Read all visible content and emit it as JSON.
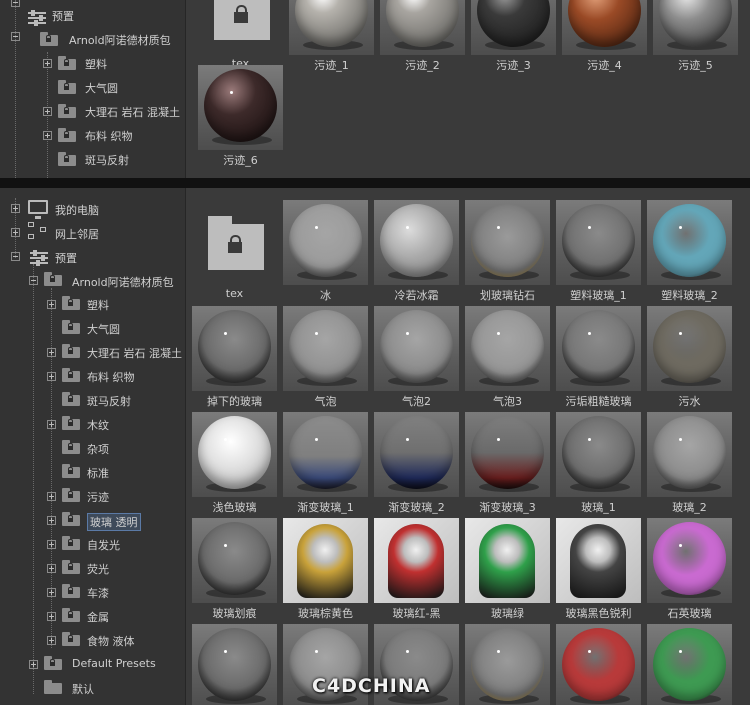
{
  "top_panel": {
    "tree": [
      {
        "label": "",
        "kind": "folder-expanded"
      },
      {
        "label": "预置",
        "kind": "presets"
      },
      {
        "label": "Arnold阿诺德材质包",
        "kind": "folder-expanded"
      },
      {
        "label": "塑料"
      },
      {
        "label": "大气圆"
      },
      {
        "label": "大理石 岩石 混凝土"
      },
      {
        "label": "布料 织物"
      },
      {
        "label": "斑马反射"
      }
    ],
    "items": [
      {
        "label": "tex",
        "type": "folder"
      },
      {
        "label": "污迹_1",
        "color": "#b5b2ac",
        "style": "rough"
      },
      {
        "label": "污迹_2",
        "color": "#a8a5a0",
        "style": "rough"
      },
      {
        "label": "污迹_3",
        "color": "#3a3a3a",
        "style": "dark"
      },
      {
        "label": "污迹_4",
        "color": "#9a4a26",
        "style": "rust"
      },
      {
        "label": "污迹_5",
        "color": "#8d8d8d",
        "style": "crack"
      },
      {
        "label": "污迹_6",
        "color": "#3d2a2a",
        "style": "darkrough"
      }
    ]
  },
  "bottom_panel": {
    "tree": [
      {
        "label": "我的电脑",
        "icon": "computer-icon"
      },
      {
        "label": "网上邻居",
        "icon": "network-icon"
      },
      {
        "label": "预置",
        "icon": "sliders-icon"
      },
      {
        "label": "Arnold阿诺德材质包",
        "icon": "folder-icon"
      },
      {
        "label": "塑料"
      },
      {
        "label": "大气圆"
      },
      {
        "label": "大理石 岩石 混凝土"
      },
      {
        "label": "布料 织物"
      },
      {
        "label": "斑马反射"
      },
      {
        "label": "木纹"
      },
      {
        "label": "杂项"
      },
      {
        "label": "标准"
      },
      {
        "label": "污迹"
      },
      {
        "label": "玻璃 透明",
        "selected": true
      },
      {
        "label": "自发光"
      },
      {
        "label": "荧光"
      },
      {
        "label": "车漆"
      },
      {
        "label": "金属"
      },
      {
        "label": "食物 液体"
      },
      {
        "label": "Default Presets"
      },
      {
        "label": "默认"
      }
    ],
    "items": [
      {
        "label": "tex",
        "type": "folder"
      },
      {
        "label": "冰",
        "color": "#9a9a9a",
        "style": "glass"
      },
      {
        "label": "冷若冰霜",
        "color": "#b0b0b0",
        "style": "frost"
      },
      {
        "label": "划玻璃钻石",
        "color": "#8a8a8a",
        "style": "glass-gold"
      },
      {
        "label": "塑料玻璃_1",
        "color": "#707070",
        "style": "glass-dark"
      },
      {
        "label": "塑料玻璃_2",
        "color": "#63a6b8",
        "style": "tint"
      },
      {
        "label": "掉下的玻璃",
        "color": "#6a6a6a",
        "style": "glass-dark"
      },
      {
        "label": "气泡",
        "color": "#909090",
        "style": "glass"
      },
      {
        "label": "气泡2",
        "color": "#8a8a8a",
        "style": "glass"
      },
      {
        "label": "气泡3",
        "color": "#959595",
        "style": "glass"
      },
      {
        "label": "污垢粗糙玻璃",
        "color": "#767676",
        "style": "glass-dark"
      },
      {
        "label": "污水",
        "color": "#6e6a60",
        "style": "tint"
      },
      {
        "label": "浅色玻璃",
        "color": "#d8d8d8",
        "style": "light"
      },
      {
        "label": "渐变玻璃_1",
        "color": "#8a8a8a",
        "style": "grad-blue"
      },
      {
        "label": "渐变玻璃_2",
        "color": "#7a7a7a",
        "style": "grad-navy"
      },
      {
        "label": "渐变玻璃_3",
        "color": "#7a7a7a",
        "style": "grad-red"
      },
      {
        "label": "玻璃_1",
        "color": "#6d6d6d",
        "style": "glass-dark"
      },
      {
        "label": "玻璃_2",
        "color": "#8a8a8a",
        "style": "glass"
      },
      {
        "label": "玻璃划痕",
        "color": "#6a6a6a",
        "style": "glass-dark"
      },
      {
        "label": "玻璃棕黄色",
        "color": "#c9a23a",
        "style": "bottle"
      },
      {
        "label": "玻璃红-黑",
        "color": "#c03030",
        "style": "bottle"
      },
      {
        "label": "玻璃绿",
        "color": "#2fa04a",
        "style": "bottle"
      },
      {
        "label": "玻璃黑色锐利",
        "color": "#444444",
        "style": "bottle"
      },
      {
        "label": "石英玻璃",
        "color": "#c96ad0",
        "style": "tint"
      },
      {
        "label": "",
        "color": "#6a6a6a",
        "style": "glass-dark"
      },
      {
        "label": "",
        "color": "#8a8a8a",
        "style": "glass"
      },
      {
        "label": "",
        "color": "#7a7a7a",
        "style": "glass-dark"
      },
      {
        "label": "",
        "color": "#8a8a8a",
        "style": "glass-gold"
      },
      {
        "label": "",
        "color": "#b83a3a",
        "style": "tint"
      },
      {
        "label": "",
        "color": "#3e9a52",
        "style": "tint"
      }
    ]
  },
  "watermark": "C4DCHINA"
}
